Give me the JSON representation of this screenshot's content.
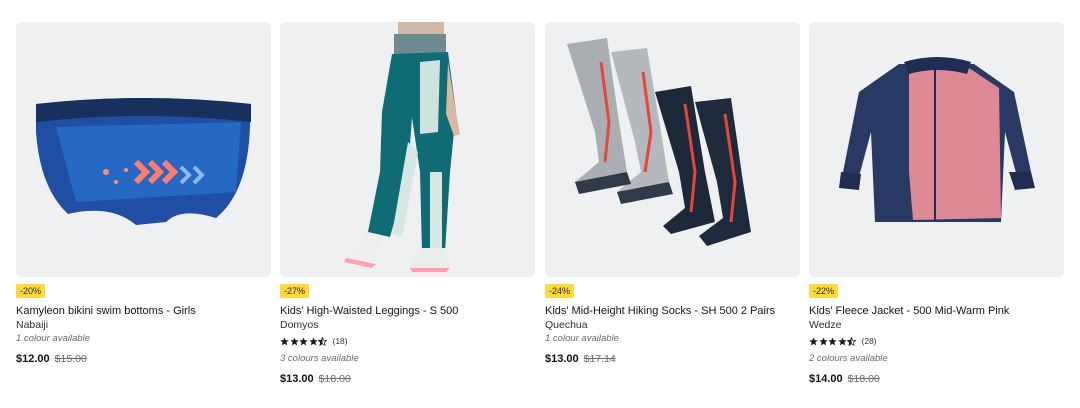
{
  "products": [
    {
      "badge": "-20%",
      "title": "Kamyleon bikini swim bottoms - Girls",
      "brand": "Nabaiji",
      "colours": "1 colour available",
      "price": "$12.00",
      "old_price": "$15.00",
      "image_icon": "swim-bottoms-image"
    },
    {
      "badge": "-27%",
      "title": "Kids' High-Waisted Leggings - S 500",
      "brand": "Domyos",
      "rating": 4.5,
      "rating_count": "(18)",
      "colours": "3 colours available",
      "price": "$13.00",
      "old_price": "$18.00",
      "image_icon": "leggings-image"
    },
    {
      "badge": "-24%",
      "title": "Kids' Mid-Height Hiking Socks - SH 500 2 Pairs",
      "brand": "Quechua",
      "colours": "1 colour available",
      "price": "$13.00",
      "old_price": "$17.14",
      "image_icon": "socks-image"
    },
    {
      "badge": "-22%",
      "title": "Kids' Fleece Jacket - 500 Mid-Warm Pink",
      "brand": "Wedze",
      "rating": 4.5,
      "rating_count": "(28)",
      "colours": "2 colours available",
      "price": "$14.00",
      "old_price": "$18.00",
      "image_icon": "fleece-jacket-image"
    }
  ],
  "colors": {
    "badge_bg": "#ffd83a",
    "image_bg": "#eff0f1",
    "star": "#1a1a1a"
  }
}
